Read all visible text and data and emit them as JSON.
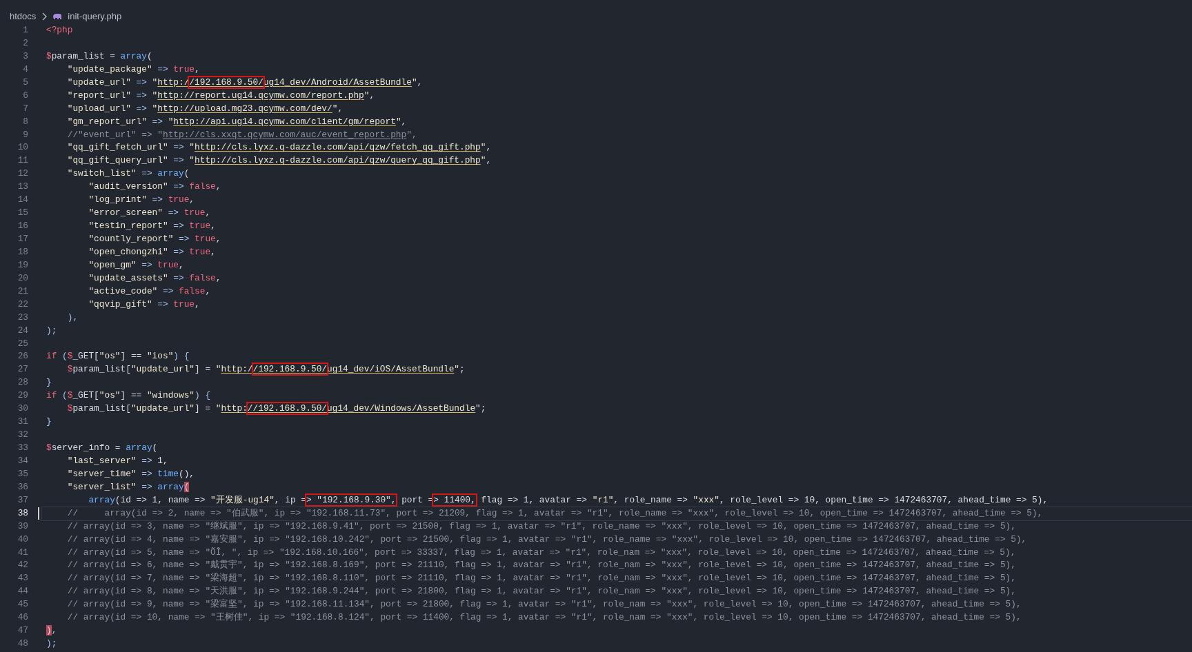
{
  "breadcrumb": [
    {
      "label": "htdocs",
      "kind": "folder"
    },
    {
      "label": "init-query.php",
      "kind": "php"
    }
  ],
  "lines": [
    {
      "number": "1",
      "current": false,
      "segments": [
        {
          "text": "<?php",
          "kind": "kw"
        }
      ]
    },
    {
      "number": "2",
      "current": false
    },
    {
      "number": "3",
      "current": false,
      "segments": [
        {
          "text": "$",
          "kind": "kw"
        },
        {
          "text": "param_list = ",
          "kind": "plain"
        },
        {
          "text": "array",
          "kind": "fn"
        },
        {
          "text": "(",
          "kind": "plain"
        }
      ]
    },
    {
      "number": "4",
      "current": false,
      "segments": [
        {
          "text": "    \"update_package\"",
          "kind": "str"
        },
        {
          "text": " => ",
          "kind": "op"
        },
        {
          "text": "true",
          "kind": "kw"
        },
        {
          "text": ",",
          "kind": "plain"
        }
      ]
    },
    {
      "number": "5",
      "current": false,
      "segments": [
        {
          "text": "    \"update_url\"",
          "kind": "str"
        },
        {
          "text": " => ",
          "kind": "op"
        },
        {
          "text": "\"",
          "kind": "str"
        },
        {
          "text": "http:/",
          "kind": "url"
        },
        {
          "text": "/192.168.9.50/",
          "kind": "url",
          "boxed": true
        },
        {
          "text": "ug14_dev/Android/AssetBundle",
          "kind": "url"
        },
        {
          "text": "\"",
          "kind": "str"
        },
        {
          "text": ",",
          "kind": "plain"
        }
      ]
    },
    {
      "number": "6",
      "current": false,
      "segments": [
        {
          "text": "    \"report_url\"",
          "kind": "str"
        },
        {
          "text": " => ",
          "kind": "op"
        },
        {
          "text": "\"",
          "kind": "str"
        },
        {
          "text": "http://report.ug14.qcymw.com/report.php",
          "kind": "url"
        },
        {
          "text": "\"",
          "kind": "str"
        },
        {
          "text": ",",
          "kind": "plain"
        }
      ]
    },
    {
      "number": "7",
      "current": false,
      "segments": [
        {
          "text": "    \"upload_url\"",
          "kind": "str"
        },
        {
          "text": " => ",
          "kind": "op"
        },
        {
          "text": "\"",
          "kind": "str"
        },
        {
          "text": "http://upload.mg23.qcymw.com/dev/",
          "kind": "url"
        },
        {
          "text": "\"",
          "kind": "str"
        },
        {
          "text": ",",
          "kind": "plain"
        }
      ]
    },
    {
      "number": "8",
      "current": false,
      "segments": [
        {
          "text": "    \"gm_report_url\"",
          "kind": "str"
        },
        {
          "text": " => ",
          "kind": "op"
        },
        {
          "text": "\"",
          "kind": "str"
        },
        {
          "text": "http://api.ug14.qcymw.com/client/gm/report",
          "kind": "url"
        },
        {
          "text": "\"",
          "kind": "str"
        },
        {
          "text": ",",
          "kind": "plain"
        }
      ]
    },
    {
      "number": "9",
      "current": false,
      "segments": [
        {
          "text": "    //\"event_url\" => \"",
          "kind": "comment"
        },
        {
          "text": "http://cls.xxqt.qcymw.com/auc/event_report.php",
          "kind": "comment-url"
        },
        {
          "text": "\",",
          "kind": "comment"
        }
      ]
    },
    {
      "number": "10",
      "current": false,
      "segments": [
        {
          "text": "    \"qq_gift_fetch_url\"",
          "kind": "str"
        },
        {
          "text": " => ",
          "kind": "op"
        },
        {
          "text": "\"",
          "kind": "str"
        },
        {
          "text": "http://cls.lyxz.q-dazzle.com/api/qzw/fetch_qq_gift.php",
          "kind": "url"
        },
        {
          "text": "\"",
          "kind": "str"
        },
        {
          "text": ",",
          "kind": "plain"
        }
      ]
    },
    {
      "number": "11",
      "current": false,
      "segments": [
        {
          "text": "    \"qq_gift_query_url\"",
          "kind": "str"
        },
        {
          "text": " => ",
          "kind": "op"
        },
        {
          "text": "\"",
          "kind": "str"
        },
        {
          "text": "http://cls.lyxz.q-dazzle.com/api/qzw/query_qq_gift.php",
          "kind": "url"
        },
        {
          "text": "\"",
          "kind": "str"
        },
        {
          "text": ",",
          "kind": "plain"
        }
      ]
    },
    {
      "number": "12",
      "current": false,
      "segments": [
        {
          "text": "    \"switch_list\"",
          "kind": "str"
        },
        {
          "text": " => ",
          "kind": "op"
        },
        {
          "text": "array",
          "kind": "fn"
        },
        {
          "text": "(",
          "kind": "plain"
        }
      ]
    },
    {
      "number": "13",
      "current": false,
      "segments": [
        {
          "text": "        \"audit_version\"",
          "kind": "str"
        },
        {
          "text": " => ",
          "kind": "op"
        },
        {
          "text": "false",
          "kind": "kw"
        },
        {
          "text": ",",
          "kind": "plain"
        }
      ]
    },
    {
      "number": "14",
      "current": false,
      "segments": [
        {
          "text": "        \"log_print\"",
          "kind": "str"
        },
        {
          "text": " => ",
          "kind": "op"
        },
        {
          "text": "true",
          "kind": "kw"
        },
        {
          "text": ",",
          "kind": "plain"
        }
      ]
    },
    {
      "number": "15",
      "current": false,
      "segments": [
        {
          "text": "        \"error_screen\"",
          "kind": "str"
        },
        {
          "text": " => ",
          "kind": "op"
        },
        {
          "text": "true",
          "kind": "kw"
        },
        {
          "text": ",",
          "kind": "plain"
        }
      ]
    },
    {
      "number": "16",
      "current": false,
      "segments": [
        {
          "text": "        \"testin_report\"",
          "kind": "str"
        },
        {
          "text": " => ",
          "kind": "op"
        },
        {
          "text": "true",
          "kind": "kw"
        },
        {
          "text": ",",
          "kind": "plain"
        }
      ]
    },
    {
      "number": "17",
      "current": false,
      "segments": [
        {
          "text": "        \"countly_report\"",
          "kind": "str"
        },
        {
          "text": " => ",
          "kind": "op"
        },
        {
          "text": "true",
          "kind": "kw"
        },
        {
          "text": ",",
          "kind": "plain"
        }
      ]
    },
    {
      "number": "18",
      "current": false,
      "segments": [
        {
          "text": "        \"open_chongzhi\"",
          "kind": "str"
        },
        {
          "text": " => ",
          "kind": "op"
        },
        {
          "text": "true",
          "kind": "kw"
        },
        {
          "text": ",",
          "kind": "plain"
        }
      ]
    },
    {
      "number": "19",
      "current": false,
      "segments": [
        {
          "text": "        \"open_gm\"",
          "kind": "str"
        },
        {
          "text": " => ",
          "kind": "op"
        },
        {
          "text": "true",
          "kind": "kw"
        },
        {
          "text": ",",
          "kind": "plain"
        }
      ]
    },
    {
      "number": "20",
      "current": false,
      "segments": [
        {
          "text": "        \"update_assets\"",
          "kind": "str"
        },
        {
          "text": " => ",
          "kind": "op"
        },
        {
          "text": "false",
          "kind": "kw"
        },
        {
          "text": ",",
          "kind": "plain"
        }
      ]
    },
    {
      "number": "21",
      "current": false,
      "segments": [
        {
          "text": "        \"active_code\"",
          "kind": "str"
        },
        {
          "text": " => ",
          "kind": "op"
        },
        {
          "text": "false",
          "kind": "kw"
        },
        {
          "text": ",",
          "kind": "plain"
        }
      ]
    },
    {
      "number": "22",
      "current": false,
      "segments": [
        {
          "text": "        \"qqvip_gift\"",
          "kind": "str"
        },
        {
          "text": " => ",
          "kind": "op"
        },
        {
          "text": "true",
          "kind": "kw"
        },
        {
          "text": ",",
          "kind": "plain"
        }
      ]
    },
    {
      "number": "23",
      "current": false,
      "segments": [
        {
          "text": "    ),",
          "kind": "op"
        }
      ]
    },
    {
      "number": "24",
      "current": false,
      "segments": [
        {
          "text": ");",
          "kind": "op"
        }
      ]
    },
    {
      "number": "25",
      "current": false
    },
    {
      "number": "26",
      "current": false,
      "segments": [
        {
          "text": "if",
          "kind": "kw"
        },
        {
          "text": " (",
          "kind": "op"
        },
        {
          "text": "$",
          "kind": "kw"
        },
        {
          "text": "_GET[",
          "kind": "plain"
        },
        {
          "text": "\"os\"",
          "kind": "str"
        },
        {
          "text": "] == ",
          "kind": "plain"
        },
        {
          "text": "\"ios\"",
          "kind": "str"
        },
        {
          "text": ") {",
          "kind": "op"
        }
      ]
    },
    {
      "number": "27",
      "current": false,
      "segments": [
        {
          "text": "    $",
          "kind": "kw"
        },
        {
          "text": "param_list[",
          "kind": "plain"
        },
        {
          "text": "\"update_url\"",
          "kind": "str"
        },
        {
          "text": "] = ",
          "kind": "plain"
        },
        {
          "text": "\"",
          "kind": "str"
        },
        {
          "text": "http:/",
          "kind": "url"
        },
        {
          "text": "/192.168.9.50/",
          "kind": "url",
          "boxed": true
        },
        {
          "text": "ug14_dev/iOS/AssetBundle",
          "kind": "url"
        },
        {
          "text": "\"",
          "kind": "str"
        },
        {
          "text": ";",
          "kind": "plain"
        }
      ]
    },
    {
      "number": "28",
      "current": false,
      "segments": [
        {
          "text": "}",
          "kind": "op"
        }
      ]
    },
    {
      "number": "29",
      "current": false,
      "segments": [
        {
          "text": "if",
          "kind": "kw"
        },
        {
          "text": " (",
          "kind": "op"
        },
        {
          "text": "$",
          "kind": "kw"
        },
        {
          "text": "_GET[",
          "kind": "plain"
        },
        {
          "text": "\"os\"",
          "kind": "str"
        },
        {
          "text": "] == ",
          "kind": "plain"
        },
        {
          "text": "\"windows\"",
          "kind": "str"
        },
        {
          "text": ") {",
          "kind": "op"
        }
      ]
    },
    {
      "number": "30",
      "current": false,
      "segments": [
        {
          "text": "    $",
          "kind": "kw"
        },
        {
          "text": "param_list[",
          "kind": "plain"
        },
        {
          "text": "\"update_url\"",
          "kind": "str"
        },
        {
          "text": "] = ",
          "kind": "plain"
        },
        {
          "text": "\"",
          "kind": "str"
        },
        {
          "text": "http:",
          "kind": "url"
        },
        {
          "text": "//192.168.9.50/",
          "kind": "url",
          "boxed": true
        },
        {
          "text": "ug14_dev/Windows/AssetBundle",
          "kind": "url"
        },
        {
          "text": "\"",
          "kind": "str"
        },
        {
          "text": ";",
          "kind": "plain"
        }
      ]
    },
    {
      "number": "31",
      "current": false,
      "segments": [
        {
          "text": "}",
          "kind": "op"
        }
      ]
    },
    {
      "number": "32",
      "current": false
    },
    {
      "number": "33",
      "current": false,
      "segments": [
        {
          "text": "$",
          "kind": "kw"
        },
        {
          "text": "server_info = ",
          "kind": "plain"
        },
        {
          "text": "array",
          "kind": "fn"
        },
        {
          "text": "(",
          "kind": "plain"
        }
      ]
    },
    {
      "number": "34",
      "current": false,
      "segments": [
        {
          "text": "    \"last_server\"",
          "kind": "str"
        },
        {
          "text": " => ",
          "kind": "op"
        },
        {
          "text": "1,",
          "kind": "plain"
        }
      ]
    },
    {
      "number": "35",
      "current": false,
      "segments": [
        {
          "text": "    \"server_time\"",
          "kind": "str"
        },
        {
          "text": " => ",
          "kind": "op"
        },
        {
          "text": "time",
          "kind": "fn"
        },
        {
          "text": "(),",
          "kind": "plain"
        }
      ]
    },
    {
      "number": "36",
      "current": false,
      "segments": [
        {
          "text": "    \"server_list\"",
          "kind": "str"
        },
        {
          "text": " => ",
          "kind": "op"
        },
        {
          "text": "array",
          "kind": "fn"
        },
        {
          "text": "(",
          "kind": "match"
        }
      ]
    },
    {
      "number": "37",
      "current": false,
      "segments": [
        {
          "text": "        array",
          "kind": "fn"
        },
        {
          "text": "(id => 1, name => ",
          "kind": "plain"
        },
        {
          "text": "\"开发服-ug14\"",
          "kind": "str"
        },
        {
          "text": ", ip =",
          "kind": "plain"
        },
        {
          "text": "> \"192.168.9.30\",",
          "kind": "plain",
          "boxed": true
        },
        {
          "text": " port =",
          "kind": "plain"
        },
        {
          "text": "> 11400,",
          "kind": "plain",
          "boxed": true
        },
        {
          "text": " flag => 1, avatar => ",
          "kind": "plain"
        },
        {
          "text": "\"r1\"",
          "kind": "str"
        },
        {
          "text": ", role_name => ",
          "kind": "plain"
        },
        {
          "text": "\"xxx\"",
          "kind": "str"
        },
        {
          "text": ", role_level => 10, open_time => 1472463707, ahead_time => 5),",
          "kind": "plain"
        }
      ]
    },
    {
      "number": "38",
      "current": true,
      "segments": [
        {
          "text": "    //     array(id => 2, name => \"伯武服\", ip => \"192.168.11.73\", port => 21209, flag => 1, avatar => \"r1\", role_name => \"xxx\", role_level => 10, open_time => 1472463707, ahead_time => 5),",
          "kind": "comment"
        }
      ]
    },
    {
      "number": "39",
      "current": false,
      "segments": [
        {
          "text": "    // array(id => 3, name => \"继斌服\", ip => \"192.168.9.41\", port => 21500, flag => 1, avatar => \"r1\", role_name => \"xxx\", role_level => 10, open_time => 1472463707, ahead_time => 5),",
          "kind": "comment"
        }
      ]
    },
    {
      "number": "40",
      "current": false,
      "segments": [
        {
          "text": "    // array(id => 4, name => \"嘉安服\", ip => \"192.168.10.242\", port => 21500, flag => 1, avatar => \"r1\", role_name => \"xxx\", role_level => 10, open_time => 1472463707, ahead_time => 5),",
          "kind": "comment"
        }
      ]
    },
    {
      "number": "41",
      "current": false,
      "segments": [
        {
          "text": "    // array(id => 5, name => \"ÕÎ, \", ip => \"192.168.10.166\", port => 33337, flag => 1, avatar => \"r1\", role_nam => \"xxx\", role_level => 10, open_time => 1472463707, ahead_time => 5),",
          "kind": "comment"
        }
      ]
    },
    {
      "number": "42",
      "current": false,
      "segments": [
        {
          "text": "    // array(id => 6, name => \"戴贯宇\", ip => \"192.168.8.169\", port => 21110, flag => 1, avatar => \"r1\", role_nam => \"xxx\", role_level => 10, open_time => 1472463707, ahead_time => 5),",
          "kind": "comment"
        }
      ]
    },
    {
      "number": "43",
      "current": false,
      "segments": [
        {
          "text": "    // array(id => 7, name => \"梁海超\", ip => \"192.168.8.110\", port => 21110, flag => 1, avatar => \"r1\", role_nam => \"xxx\", role_level => 10, open_time => 1472463707, ahead_time => 5),",
          "kind": "comment"
        }
      ]
    },
    {
      "number": "44",
      "current": false,
      "segments": [
        {
          "text": "    // array(id => 8, name => \"天洪服\", ip => \"192.168.9.244\", port => 21800, flag => 1, avatar => \"r1\", role_nam => \"xxx\", role_level => 10, open_time => 1472463707, ahead_time => 5),",
          "kind": "comment"
        }
      ]
    },
    {
      "number": "45",
      "current": false,
      "segments": [
        {
          "text": "    // array(id => 9, name => \"梁富坚\", ip => \"192.168.11.134\", port => 21800, flag => 1, avatar => \"r1\", role_nam => \"xxx\", role_level => 10, open_time => 1472463707, ahead_time => 5),",
          "kind": "comment"
        }
      ]
    },
    {
      "number": "46",
      "current": false,
      "segments": [
        {
          "text": "    // array(id => 10, name => \"王树佳\", ip => \"192.168.8.124\", port => 11400, flag => 1, avatar => \"r1\", role_nam => \"xxx\", role_level => 10, open_time => 1472463707, ahead_time => 5),",
          "kind": "comment"
        }
      ]
    },
    {
      "number": "47",
      "current": false,
      "segments": [
        {
          "text": ")",
          "kind": "match"
        },
        {
          "text": ",",
          "kind": "op"
        }
      ]
    },
    {
      "number": "48",
      "current": false,
      "segments": [
        {
          "text": ");",
          "kind": "op"
        }
      ]
    }
  ]
}
